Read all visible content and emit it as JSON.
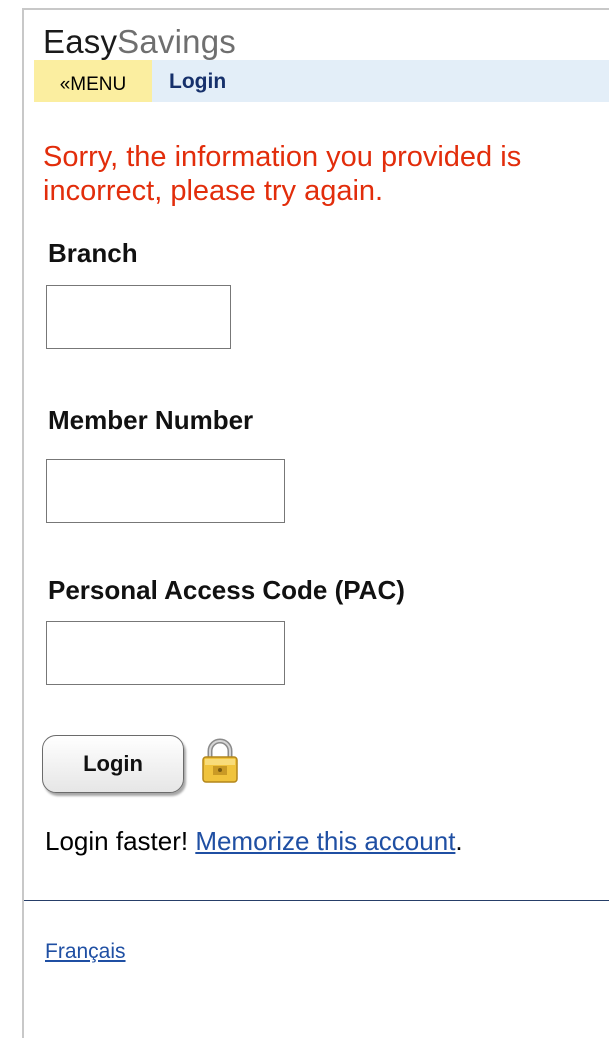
{
  "header": {
    "brand_part1": "Easy",
    "brand_part2": "Savings"
  },
  "nav": {
    "menu_label": "«MENU",
    "breadcrumb": "Login"
  },
  "error_message": "Sorry, the information you provided is incorrect, please try again.",
  "form": {
    "branch_label": "Branch",
    "branch_value": "",
    "member_label": "Member Number",
    "member_value": "",
    "pac_label": "Personal Access Code (PAC)",
    "pac_value": "",
    "login_button": "Login",
    "secure_icon": "padlock-icon"
  },
  "footer": {
    "faster_text": "Login faster! ",
    "memorize_link": "Memorize this account",
    "period": ".",
    "language_link": "Français"
  },
  "colors": {
    "error": "#e22d0b",
    "nav_bg": "#e3eef8",
    "menu_bg": "#fbeea0",
    "link": "#1f4fa3"
  }
}
